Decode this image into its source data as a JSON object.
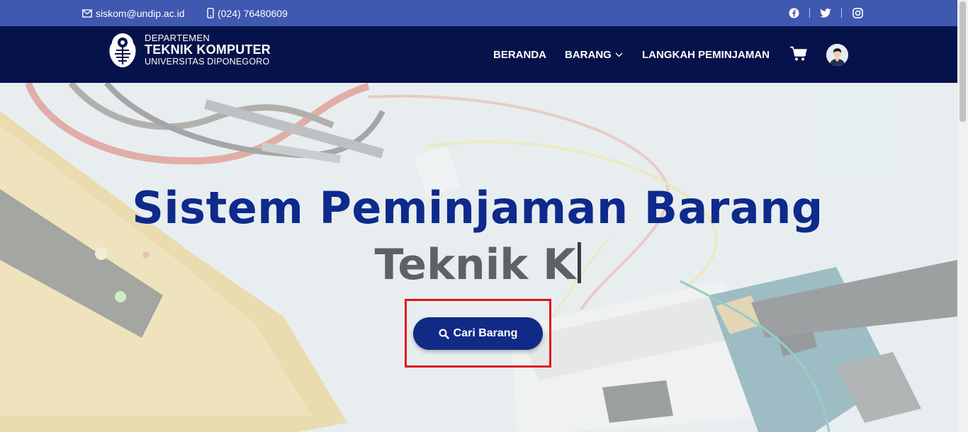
{
  "topbar": {
    "email": "siskom@undip.ac.id",
    "phone": "(024) 76480609",
    "email_icon": "envelope-icon",
    "phone_icon": "phone-icon",
    "social": [
      "facebook-icon",
      "twitter-icon",
      "instagram-icon"
    ],
    "bg_color": "#3f58b0"
  },
  "header": {
    "brand": {
      "line1": "DEPARTEMEN",
      "line2": "TEKNIK KOMPUTER",
      "line3": "UNIVERSITAS DIPONEGORO",
      "logo_icon": "undip-logo"
    },
    "nav": {
      "beranda": "BERANDA",
      "barang": "BARANG",
      "langkah": "LANGKAH PEMINJAMAN"
    },
    "cart_icon": "cart-icon",
    "avatar_icon": "user-avatar",
    "bg_color": "#06124a"
  },
  "hero": {
    "title": "Sistem Peminjaman Barang",
    "typed_text": "Teknik K",
    "cta_label": "Cari Barang",
    "cta_icon": "search-icon",
    "title_color": "#0d2a8c",
    "cta_color": "#102a86",
    "highlight_color": "#e3131e"
  }
}
